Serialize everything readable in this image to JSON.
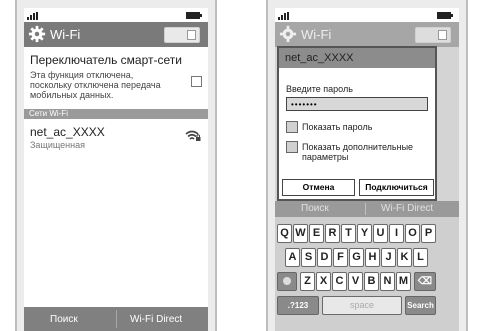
{
  "left_screen": {
    "title": "Wi-Fi",
    "smart_switch": {
      "heading": "Переключатель смарт-сети",
      "description": "Эта функция отключена, поскольку отключена передача мобильных данных."
    },
    "section_header": "Сети Wi-Fi",
    "network": {
      "name": "net_ac_XXXX",
      "status": "Защищенная"
    },
    "bottom_bar": {
      "search": "Поиск",
      "wifi_direct": "Wi-Fi Direct"
    }
  },
  "right_screen": {
    "background_title": "Wi-Fi",
    "dialog": {
      "title": "net_ac_XXXX",
      "password_label": "Введите пароль",
      "password_value": "•••••••",
      "show_password": "Показать пароль",
      "show_advanced": "Показать дополнительные параметры",
      "cancel": "Отмена",
      "connect": "Подключиться"
    },
    "behind_bar": {
      "search": "Поиск",
      "wifi_direct": "Wi-Fi Direct"
    },
    "keyboard": {
      "row1": [
        "Q",
        "W",
        "E",
        "R",
        "T",
        "Y",
        "U",
        "I",
        "O",
        "P"
      ],
      "row2": [
        "A",
        "S",
        "D",
        "F",
        "G",
        "H",
        "J",
        "K",
        "L"
      ],
      "row3": [
        "Z",
        "X",
        "C",
        "V",
        "B",
        "N",
        "M"
      ],
      "mode_key": ".?123",
      "space": "space",
      "search_key": "Search"
    }
  }
}
